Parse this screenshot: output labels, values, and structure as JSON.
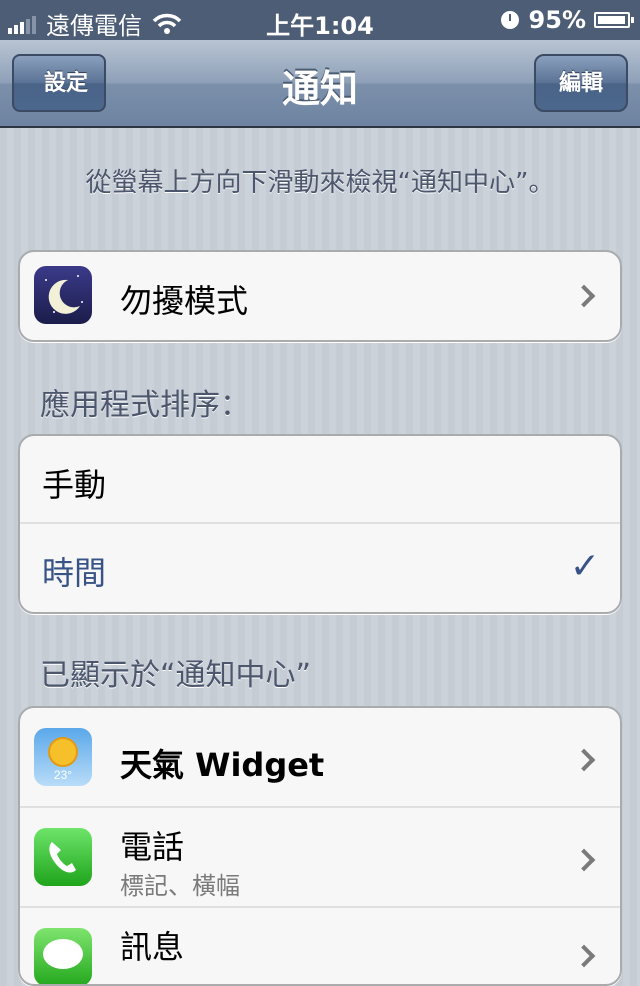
{
  "status_bar": {
    "carrier": "遠傳電信",
    "time": "上午1:04",
    "battery": "95%",
    "battery_level": 0.95
  },
  "nav": {
    "back_label": "設定",
    "title": "通知",
    "edit_label": "編輯"
  },
  "hint": "從螢幕上方向下滑動來檢視“通知中心”。",
  "dnd": {
    "label": "勿擾模式",
    "icon": "moon-icon"
  },
  "sort": {
    "header": "應用程式排序：",
    "options": [
      {
        "label": "手動",
        "selected": false
      },
      {
        "label": "時間",
        "selected": true
      }
    ]
  },
  "shown": {
    "header": "已顯示於“通知中心”",
    "apps": [
      {
        "name": "天氣 Widget",
        "subtitle": "",
        "icon": "weather-icon",
        "icon_text": "23°"
      },
      {
        "name": "電話",
        "subtitle": "標記、橫幅",
        "icon": "phone-icon"
      },
      {
        "name": "訊息",
        "subtitle": "",
        "icon": "messages-icon"
      }
    ]
  },
  "colors": {
    "status_bar": "#4e5d76",
    "selected_text": "#385487",
    "background": "#c5ccd4"
  }
}
